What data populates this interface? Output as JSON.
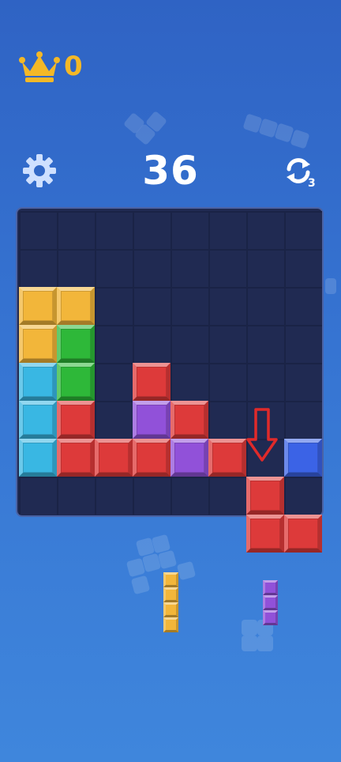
{
  "header": {
    "best_score": "0",
    "score": "36",
    "refresh_count": "3"
  },
  "colors": {
    "yellow": "#f2b63a",
    "green": "#2eb839",
    "cyan": "#39b7e3",
    "red": "#dd3a3a",
    "purple": "#9151d9",
    "blue": "#3b63e6",
    "board": "#202a52",
    "crown": "#f4b827",
    "arrow": "#e02a2a"
  },
  "icons": {
    "best": "crown-icon",
    "settings": "gear-icon",
    "refresh": "refresh-icon",
    "hint": "down-arrow-icon"
  },
  "board": {
    "size": 8,
    "cells": [
      {
        "row": 2,
        "col": 0,
        "color": "yellow"
      },
      {
        "row": 2,
        "col": 1,
        "color": "yellow"
      },
      {
        "row": 3,
        "col": 0,
        "color": "yellow"
      },
      {
        "row": 3,
        "col": 1,
        "color": "green"
      },
      {
        "row": 4,
        "col": 0,
        "color": "cyan"
      },
      {
        "row": 4,
        "col": 1,
        "color": "green"
      },
      {
        "row": 4,
        "col": 3,
        "color": "red"
      },
      {
        "row": 5,
        "col": 0,
        "color": "cyan"
      },
      {
        "row": 5,
        "col": 1,
        "color": "red"
      },
      {
        "row": 5,
        "col": 3,
        "color": "purple"
      },
      {
        "row": 5,
        "col": 4,
        "color": "red"
      },
      {
        "row": 6,
        "col": 0,
        "color": "cyan"
      },
      {
        "row": 6,
        "col": 1,
        "color": "red"
      },
      {
        "row": 6,
        "col": 2,
        "color": "red"
      },
      {
        "row": 6,
        "col": 3,
        "color": "red"
      },
      {
        "row": 6,
        "col": 4,
        "color": "purple"
      },
      {
        "row": 6,
        "col": 5,
        "color": "red"
      },
      {
        "row": 6,
        "col": 7,
        "color": "blue"
      }
    ],
    "dragging_piece": {
      "color": "red",
      "cells": [
        [
          7,
          6
        ],
        [
          8,
          6
        ],
        [
          8,
          7
        ]
      ]
    }
  },
  "tray": [
    {
      "name": "yellow-i4-piece",
      "color": "yellow",
      "orientation": "vertical",
      "length": 4
    },
    {
      "name": "purple-i3-piece",
      "color": "purple",
      "orientation": "vertical",
      "length": 3
    }
  ]
}
